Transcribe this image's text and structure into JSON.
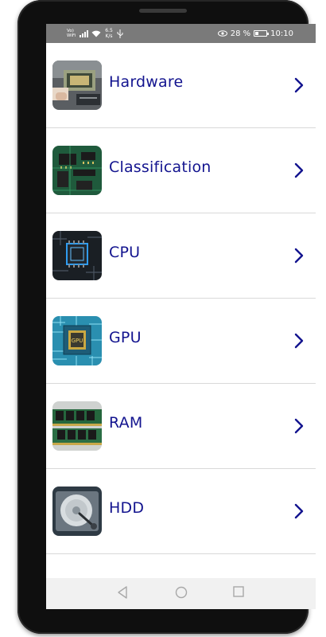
{
  "status_bar": {
    "carrier": "Vo) WiFi",
    "speed_value": "6.5",
    "speed_unit": "K/s",
    "battery_percent": "28 %",
    "battery_level": 0.28,
    "time": "10:10",
    "icons": [
      "signal-icon",
      "wifi-icon",
      "usb-icon",
      "eye-comfort-icon",
      "battery-icon"
    ]
  },
  "list": {
    "items": [
      {
        "label": "Hardware",
        "icon": "hardware-thumbnail"
      },
      {
        "label": "Classification",
        "icon": "circuit-board-thumbnail"
      },
      {
        "label": "CPU",
        "icon": "cpu-chip-thumbnail"
      },
      {
        "label": "GPU",
        "icon": "gpu-chip-thumbnail"
      },
      {
        "label": "RAM",
        "icon": "ram-module-thumbnail"
      },
      {
        "label": "HDD",
        "icon": "hard-disk-thumbnail"
      }
    ],
    "text_color": "#13148f",
    "chevron_color": "#13148f"
  },
  "nav_bar": {
    "buttons": [
      "back-icon",
      "home-icon",
      "recents-icon"
    ]
  }
}
